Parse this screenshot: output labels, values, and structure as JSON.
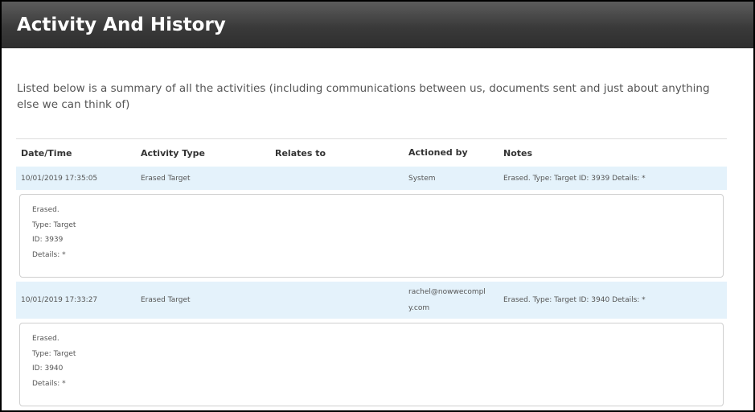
{
  "page": {
    "title": "Activity And History"
  },
  "intro": "Listed below is a summary of all the activities (including communications between us, documents sent and just about anything else we can think of)",
  "table": {
    "columns": [
      "Date/Time",
      "Activity Type",
      "Relates to",
      "Actioned by",
      "Notes"
    ],
    "rows": [
      {
        "datetime": "10/01/2019 17:35:05",
        "activity_type": "Erased Target",
        "relates_to": "",
        "actioned_by": "System",
        "notes": "Erased. Type: Target ID: 3939 Details: *",
        "details": [
          "Erased.",
          "Type: Target",
          "ID: 3939",
          "Details: *"
        ]
      },
      {
        "datetime": "10/01/2019 17:33:27",
        "activity_type": "Erased Target",
        "relates_to": "",
        "actioned_by": "rachel@nowwecomply.com",
        "actioned_by_lines": [
          "rachel@nowwecompl",
          "y.com"
        ],
        "notes": "Erased. Type: Target ID: 3940 Details: *",
        "details": [
          "Erased.",
          "Type: Target",
          "ID: 3940",
          "Details: *"
        ]
      }
    ]
  }
}
